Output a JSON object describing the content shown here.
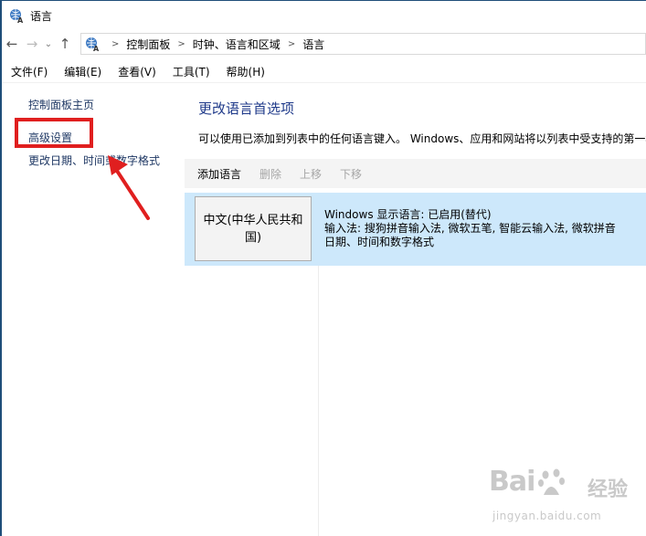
{
  "window": {
    "title": "语言"
  },
  "nav": {
    "back_icon": "arrow-left-icon",
    "forward_icon": "arrow-right-icon",
    "recent_icon": "chevron-down-icon",
    "up_icon": "arrow-up-icon"
  },
  "breadcrumb": {
    "items": [
      "控制面板",
      "时钟、语言和区域",
      "语言"
    ]
  },
  "menu": {
    "items": [
      "文件(F)",
      "编辑(E)",
      "查看(V)",
      "工具(T)",
      "帮助(H)"
    ]
  },
  "sidebar": {
    "links": [
      "控制面板主页",
      "高级设置",
      "更改日期、时间或数字格式"
    ]
  },
  "main": {
    "title": "更改语言首选项",
    "description": "可以使用已添加到列表中的任何语言键入。 Windows、应用和网站将以列表中受支持的第一种语言显示。",
    "toolbar": {
      "add": "添加语言",
      "remove": "删除",
      "move_up": "上移",
      "move_down": "下移"
    },
    "languages": [
      {
        "name": "中文(中华人民共和国)",
        "display_line": "Windows 显示语言: 已启用(替代)",
        "input_line": "输入法: 搜狗拼音输入法, 微软五笔, 智能云输入法, 微软拼音",
        "format_line": "日期、时间和数字格式"
      }
    ]
  },
  "colors": {
    "link": "#1f3864",
    "title": "#1f3a8a",
    "selected_row": "#cde8fb",
    "annotation_red": "#e01f1f"
  },
  "watermark": {
    "brand": "Bai",
    "brand_cn": "经验",
    "url": "jingyan.baidu.com"
  }
}
